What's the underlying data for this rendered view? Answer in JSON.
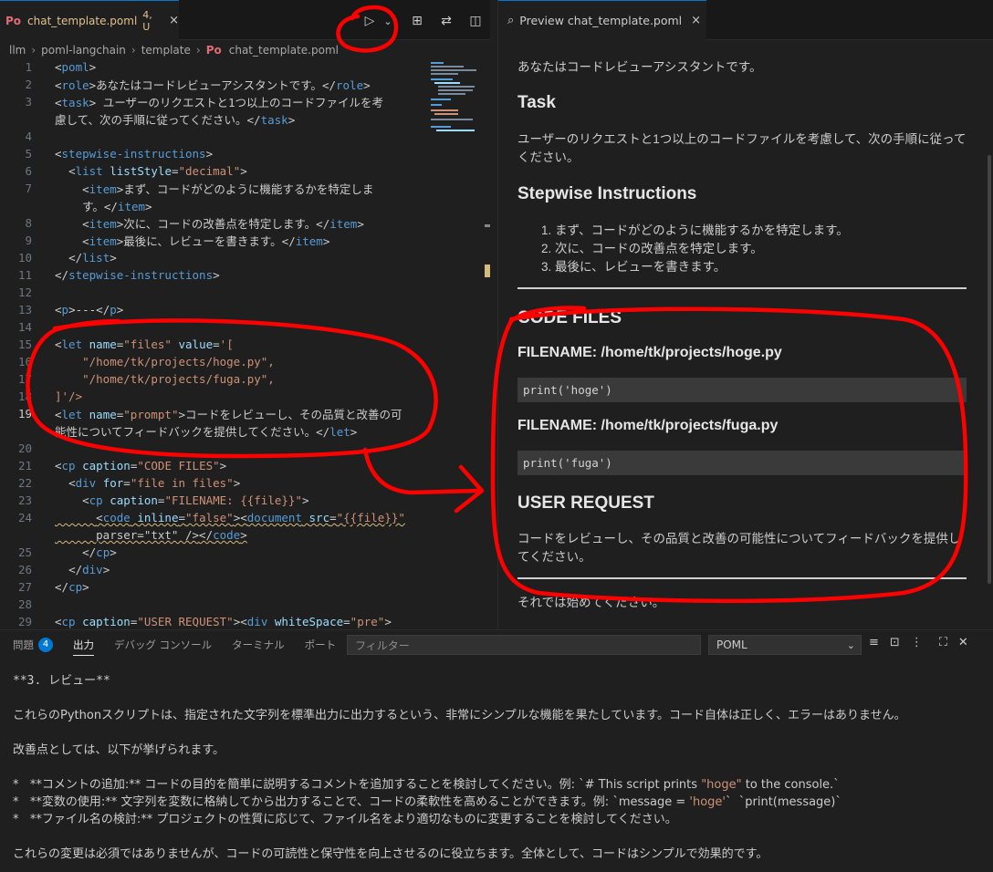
{
  "editor": {
    "tab": {
      "icon": "poml-file-icon",
      "icon_text": "Po",
      "title": "chat_template.poml",
      "badge": "4, U",
      "close": "×"
    },
    "toolbar": {
      "run": "▷",
      "run_menu": "⌄",
      "preview": "⊞",
      "compare": "⇄",
      "split": "◫",
      "more": "···"
    },
    "breadcrumb": [
      "llm",
      "poml-langchain",
      "template",
      "chat_template.poml"
    ],
    "breadcrumb_file_icon": "Po",
    "line_numbers": [
      "1",
      "2",
      "3",
      "",
      "4",
      "5",
      "6",
      "7",
      "",
      "8",
      "9",
      "10",
      "11",
      "12",
      "13",
      "14",
      "15",
      "16",
      "17",
      "18",
      "19",
      "",
      "20",
      "21",
      "22",
      "23",
      "24",
      "",
      "25",
      "26",
      "27",
      "28",
      "29"
    ],
    "code_lines": [
      "<poml>",
      "<role>あなたはコードレビューアシスタントです。</role>",
      "<task> ユーザーのリクエストと1つ以上のコードファイルを考",
      "慮して、次の手順に従ってください。</task>",
      "",
      "<stepwise-instructions>",
      "  <list listStyle=\"decimal\">",
      "    <item>まず、コードがどのように機能するかを特定しま",
      "    す。</item>",
      "    <item>次に、コードの改善点を特定します。</item>",
      "    <item>最後に、レビューを書きます。</item>",
      "  </list>",
      "</stepwise-instructions>",
      "",
      "<p>---</p>",
      "",
      "<let name=\"files\" value='[",
      "    \"/home/tk/projects/hoge.py\",",
      "    \"/home/tk/projects/fuga.py\",",
      "]'/>",
      "<let name=\"prompt\">コードをレビューし、その品質と改善の可",
      "能性についてフィードバックを提供してください。</let>",
      "",
      "<cp caption=\"CODE FILES\">",
      "  <div for=\"file in files\">",
      "    <cp caption=\"FILENAME: {{file}}\">",
      "      <code inline=\"false\"><document src=\"{{file}}\"",
      "      parser=\"txt\" /></code>",
      "    </cp>",
      "  </div>",
      "</cp>",
      "",
      "<cp caption=\"USER REQUEST\"><div whiteSpace=\"pre\">"
    ]
  },
  "preview": {
    "tab": {
      "icon": "preview-icon",
      "title": "Preview chat_template.poml",
      "close": "×"
    },
    "role_text": "あなたはコードレビューアシスタントです。",
    "task_heading": "Task",
    "task_text": "ユーザーのリクエストと1つ以上のコードファイルを考慮して、次の手順に従ってください。",
    "stepwise_heading": "Stepwise Instructions",
    "steps": [
      "1. まず、コードがどのように機能するかを特定します。",
      "2. 次に、コードの改善点を特定します。",
      "3. 最後に、レビューを書きます。"
    ],
    "code_files_heading": "CODE FILES",
    "files": [
      {
        "heading": "FILENAME: /home/tk/projects/hoge.py",
        "code": "print('hoge')"
      },
      {
        "heading": "FILENAME: /home/tk/projects/fuga.py",
        "code": "print('fuga')"
      }
    ],
    "user_request_heading": "USER REQUEST",
    "user_request_text": "コードをレビューし、その品質と改善の可能性についてフィードバックを提供してください。",
    "closing_text": "それでは始めてください。"
  },
  "panel": {
    "tabs": [
      {
        "label": "問題",
        "badge": "4"
      },
      {
        "label": "出力"
      },
      {
        "label": "デバッグ コンソール"
      },
      {
        "label": "ターミナル"
      },
      {
        "label": "ポート"
      }
    ],
    "filter_placeholder": "フィルター",
    "channel": "POML",
    "output": {
      "l1": "**3. レビュー**",
      "l2": "これらのPythonスクリプトは、指定された文字列を標準出力に出力するという、非常にシンプルな機能を果たしています。コード自体は正しく、エラーはありません。",
      "l3": "改善点としては、以下が挙げられます。",
      "b1_pre": "*   **コメントの追加:** コードの目的を簡単に説明するコメントを追加することを検討してください。例: `# This script prints ",
      "b1_str": "\"hoge\"",
      "b1_post": " to the console.`",
      "b2_pre": "*   **変数の使用:** 文字列を変数に格納してから出力することで、コードの柔軟性を高めることができます。例: `message = ",
      "b2_str": "'hoge'",
      "b2_post": "`  `print(message)`",
      "b3": "*   **ファイル名の検討:** プロジェクトの性質に応じて、ファイル名をより適切なものに変更することを検討してください。",
      "l4": "これらの変更は必須ではありませんが、コードの可読性と保守性を向上させるのに役立ちます。全体として、コードはシンプルで効果的です。"
    }
  },
  "colors": {
    "accent": "#0078d4",
    "annotation": "#ff0000",
    "tag": "#569cd6",
    "attr": "#9cdcfe",
    "string": "#ce9178"
  }
}
